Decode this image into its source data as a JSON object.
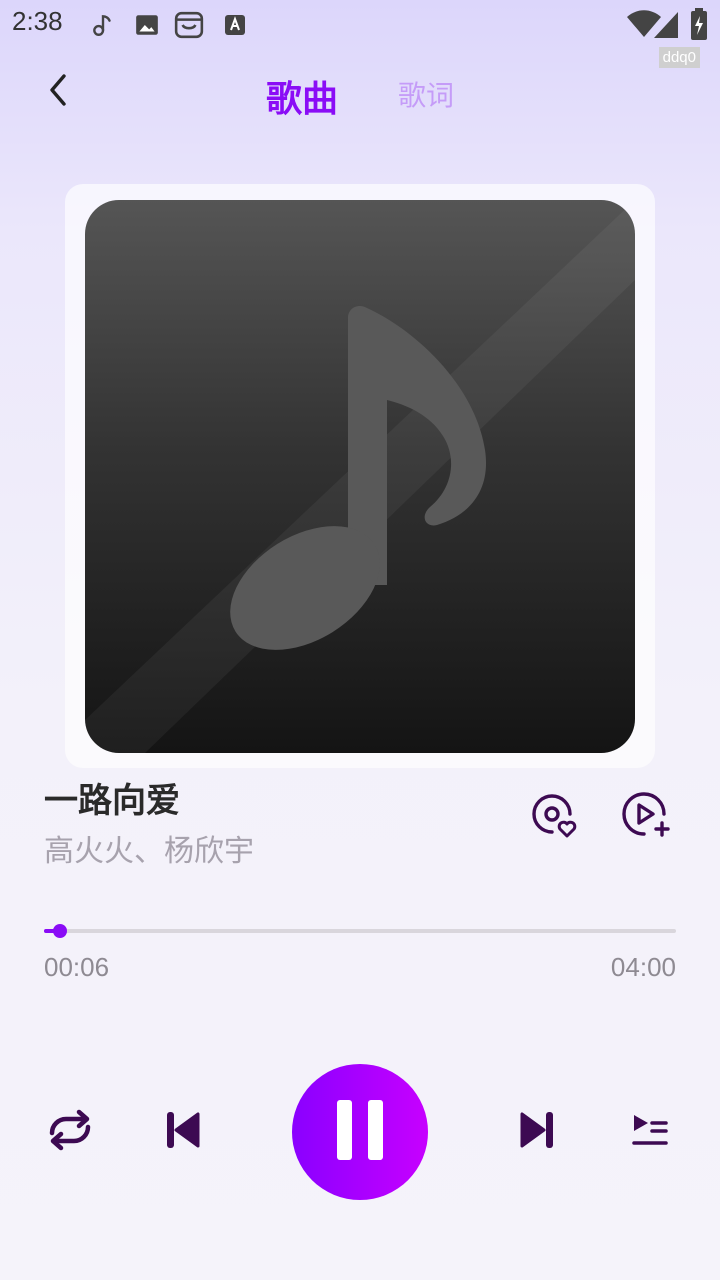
{
  "status_bar": {
    "time": "2:38",
    "badge": "ddq0"
  },
  "header": {
    "tabs": [
      {
        "label": "歌曲",
        "active": true
      },
      {
        "label": "歌词",
        "active": false
      }
    ]
  },
  "song": {
    "title": "一路向爱",
    "artist": "高火火、杨欣宇"
  },
  "progress": {
    "current": "00:06",
    "total": "04:00",
    "fraction": 0.025
  },
  "controls": {
    "repeat_mode": "repeat-all",
    "state": "playing"
  },
  "colors": {
    "accent": "#8a0cf6",
    "accent_light": "#c59cf8",
    "icon_dark": "#3d0a52",
    "play_gradient_start": "#8a00ff",
    "play_gradient_end": "#c700ff"
  },
  "icons": {
    "back": "chevron-left-icon",
    "favorite": "disc-heart-icon",
    "add_to_playlist": "play-add-icon",
    "repeat": "repeat-icon",
    "previous": "skip-previous-icon",
    "pause": "pause-icon",
    "next": "skip-next-icon",
    "queue": "queue-list-icon"
  }
}
